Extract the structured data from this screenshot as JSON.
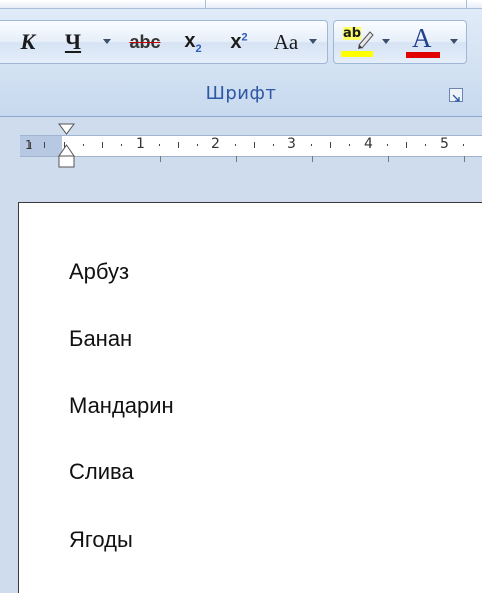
{
  "ribbon": {
    "group_label": "Шрифт",
    "buttons": {
      "italic": "К",
      "underline": "Ч",
      "strikethrough": "abc",
      "subscript_base": "x",
      "subscript_sub": "2",
      "superscript_base": "x",
      "superscript_sup": "2",
      "change_case": "Aa",
      "highlight_glyph": "ab",
      "font_color_glyph": "A"
    },
    "colors": {
      "highlight": "#ffff00",
      "font_color": "#e00000"
    }
  },
  "ruler": {
    "numbers": [
      "1",
      "1",
      "2",
      "3",
      "4",
      "5"
    ]
  },
  "document": {
    "lines": [
      "Арбуз",
      "Банан",
      "Мандарин",
      "Слива",
      "Ягоды"
    ]
  }
}
